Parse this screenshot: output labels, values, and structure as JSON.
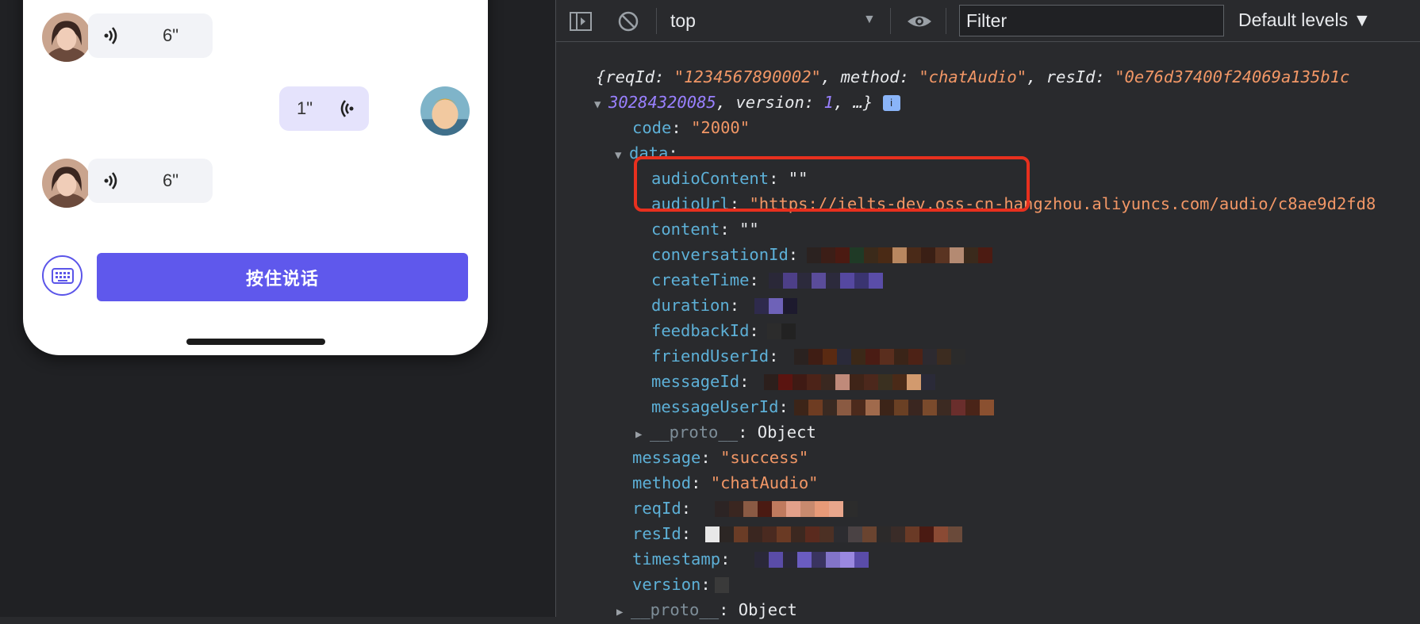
{
  "chat": {
    "messages": [
      {
        "side": "in",
        "duration": "6\""
      },
      {
        "side": "out",
        "duration": "1\""
      },
      {
        "side": "in",
        "duration": "6\""
      }
    ],
    "keyboard_icon": "keyboard-icon",
    "talk_button": "按住说话"
  },
  "devtools": {
    "toolbar": {
      "context": "top",
      "filter_placeholder": "Filter",
      "levels": "Default levels ▼"
    },
    "summary": {
      "open": "{",
      "reqId_key": "reqId",
      "reqId_val": "\"1234567890002\"",
      "method_key": "method",
      "method_val": "\"chatAudio\"",
      "resId_key": "resId",
      "resId_val": "\"0e76d37400f24069a135b1c",
      "line2_num": "30284320085",
      "version_key": "version",
      "version_val": "1",
      "tail": ", …}",
      "info": "i"
    },
    "entries": {
      "code_key": "code",
      "code_val": "\"2000\"",
      "data_key": "data",
      "audioContent_key": "audioContent",
      "audioContent_val": "\"\"",
      "audioUrl_key": "audioUrl",
      "audioUrl_val": "\"https://ielts-dev.oss-cn-hangzhou.aliyuncs.com/audio/c8ae9d2fd8",
      "content_key": "content",
      "content_val": "\"\"",
      "conversationId_key": "conversationId",
      "createTime_key": "createTime",
      "duration_key": "duration",
      "feedbackId_key": "feedbackId",
      "friendUserId_key": "friendUserId",
      "messageId_key": "messageId",
      "messageUserId_key": "messageUserId",
      "proto_key": "__proto__",
      "proto_val": "Object",
      "message_key": "message",
      "message_val": "\"success\"",
      "method_key": "method",
      "method_val": "\"chatAudio\"",
      "reqId_key": "reqId",
      "resId_key": "resId",
      "timestamp_key": "timestamp",
      "version_key": "version",
      "proto2_key": "__proto__",
      "proto2_val": "Object"
    },
    "colors": {
      "key": "#5db0d7",
      "string": "#f29766",
      "number": "#9980ff",
      "highlight": "#e8301e"
    }
  }
}
